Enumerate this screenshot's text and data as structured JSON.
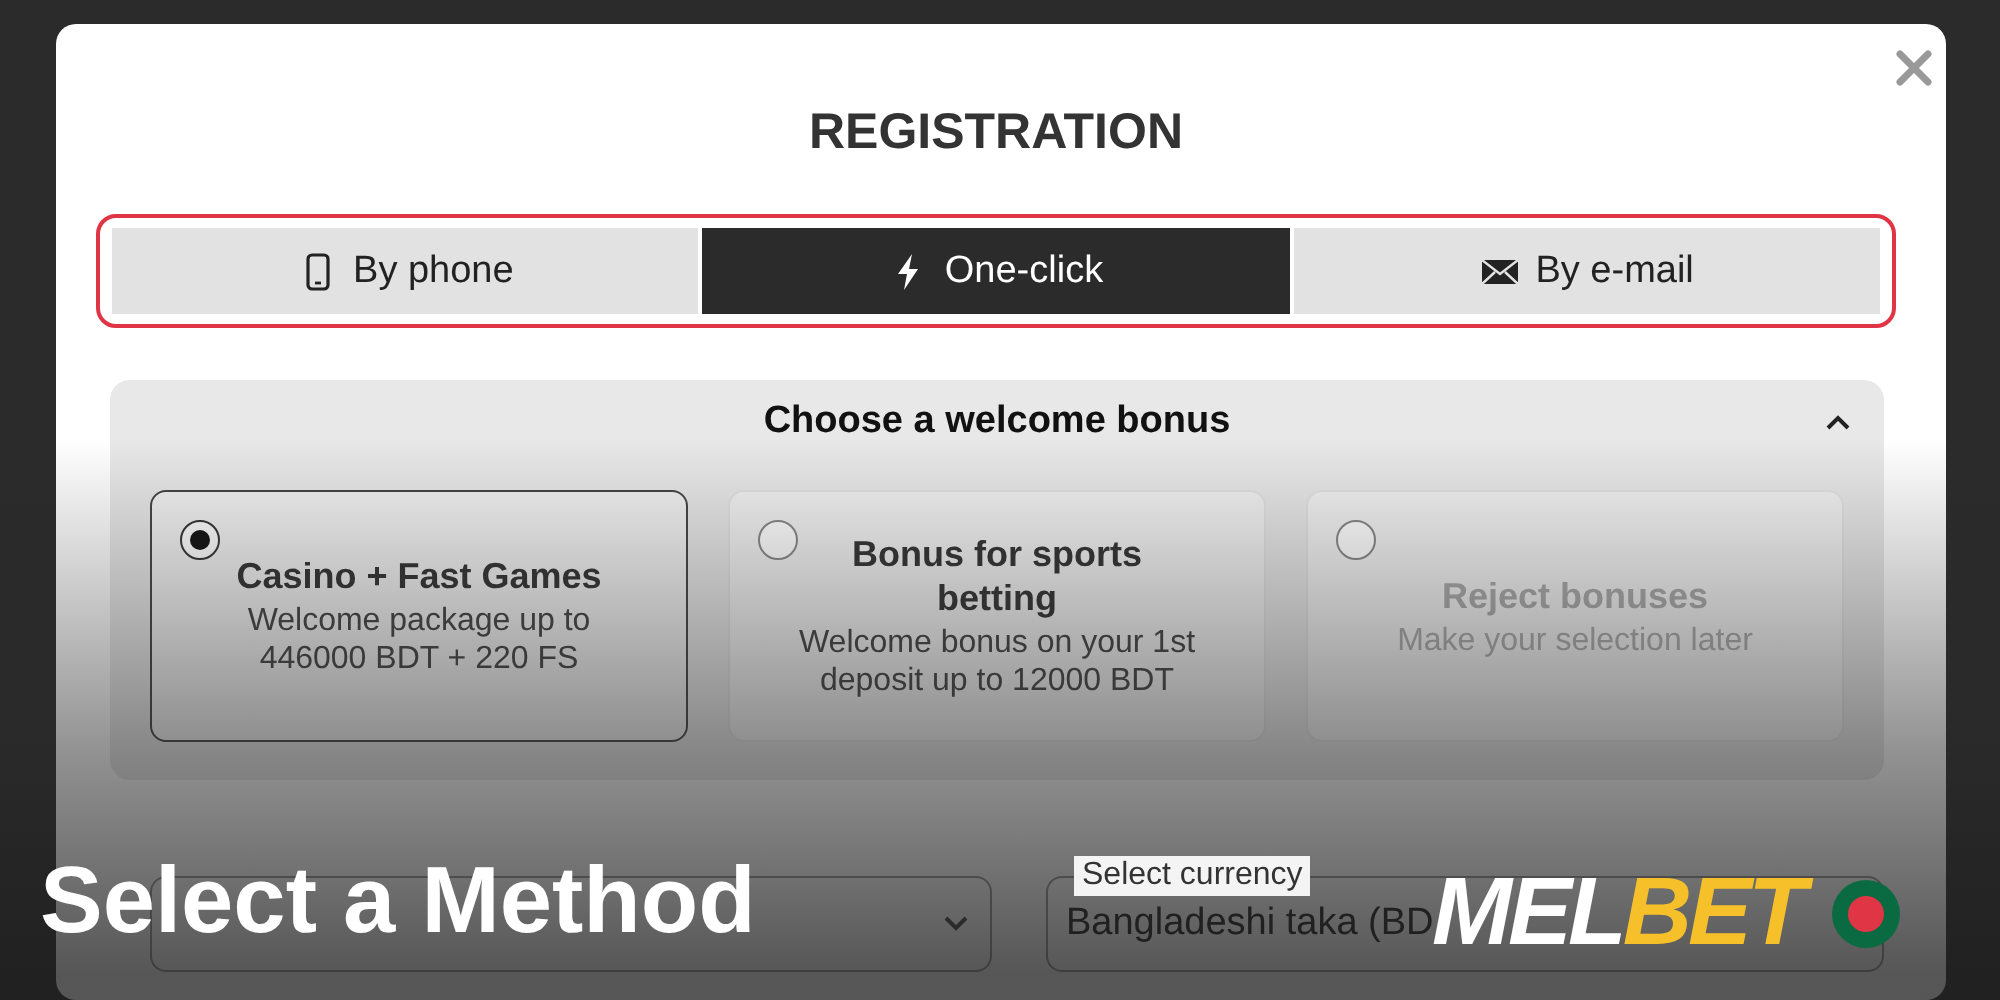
{
  "window": {
    "title": "REGISTRATION"
  },
  "tabs": [
    {
      "label": "By phone",
      "kind": "phone",
      "selected": false
    },
    {
      "label": "One-click",
      "kind": "bolt",
      "selected": true
    },
    {
      "label": "By e-mail",
      "kind": "mail",
      "selected": false
    }
  ],
  "bonus_section": {
    "title": "Choose a welcome bonus",
    "expanded": true,
    "options": [
      {
        "title": "Casino + Fast Games",
        "description": "Welcome package up to 446000 BDT + 220 FS",
        "selected": true,
        "disabled": false
      },
      {
        "title": "Bonus for sports betting",
        "description": "Welcome bonus on your 1st deposit up to 12000 BDT",
        "selected": false,
        "disabled": false
      },
      {
        "title": "Reject bonuses",
        "description": "Make your selection later",
        "selected": false,
        "disabled": true
      }
    ]
  },
  "fields": [
    {
      "label": "Select currency",
      "value": "Bangladeshi taka (BD"
    }
  ],
  "caption": {
    "text": "Select a Method",
    "logo_part_1": "MEL",
    "logo_part_2": "BET"
  }
}
